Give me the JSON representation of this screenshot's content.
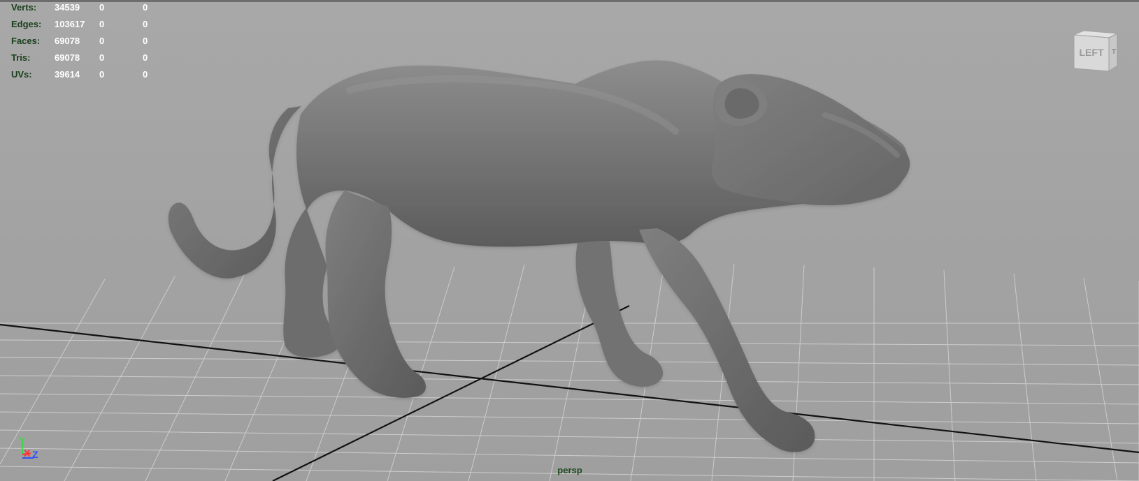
{
  "viewport": {
    "background": "#a2a2a2",
    "camera": "persp",
    "view_cube_label": "LEFT"
  },
  "heads_up_display": {
    "rows": [
      {
        "label": "Verts:",
        "value": "34539",
        "col2": "0",
        "col3": "0"
      },
      {
        "label": "Edges:",
        "value": "103617",
        "col2": "0",
        "col3": "0"
      },
      {
        "label": "Faces:",
        "value": "69078",
        "col2": "0",
        "col3": "0"
      },
      {
        "label": "Tris:",
        "value": "69078",
        "col2": "0",
        "col3": "0"
      },
      {
        "label": "UVs:",
        "value": "39614",
        "col2": "0",
        "col3": "0"
      }
    ]
  },
  "axis": {
    "y": "Y",
    "x": "X",
    "z": "Z"
  },
  "colors": {
    "hud_label": "#183f1a",
    "hud_value": "#ffffff",
    "axis_x": "#ff3030",
    "axis_y": "#3ad94c",
    "axis_z": "#2e51ff"
  },
  "model": {
    "name_icon": "panther-model"
  }
}
